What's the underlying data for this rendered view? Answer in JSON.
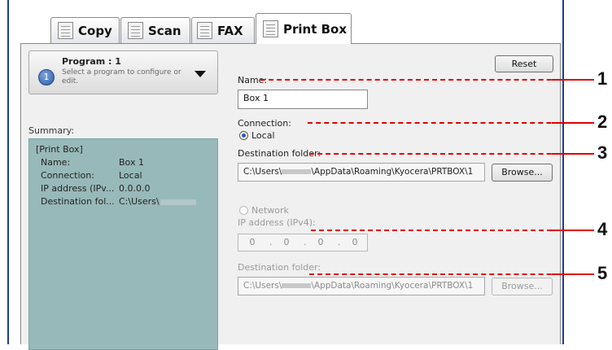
{
  "tabs": [
    {
      "label": "Copy",
      "icon": "copy-icon"
    },
    {
      "label": "Scan",
      "icon": "scan-icon"
    },
    {
      "label": "FAX",
      "icon": "fax-icon"
    },
    {
      "label": "Print Box",
      "icon": "print-box-icon",
      "active": true
    }
  ],
  "program": {
    "number": "1",
    "title": "Program : 1",
    "hint": "Select a program to configure or edit."
  },
  "summary": {
    "label": "Summary:",
    "title": "[Print Box]",
    "rows": [
      {
        "key": "Name:",
        "value": "Box 1"
      },
      {
        "key": "Connection:",
        "value": "Local"
      },
      {
        "key": "IP address (IPv...",
        "value": "0.0.0.0"
      },
      {
        "key": "Destination fol...",
        "value": "C:\\Users\\"
      }
    ]
  },
  "form": {
    "reset_label": "Reset",
    "name_label": "Name:",
    "name_value": "Box 1",
    "connection_label": "Connection:",
    "local_label": "Local",
    "dest_label": "Destination folder:",
    "dest_path_prefix": "C:\\Users\\",
    "dest_path_suffix": "\\AppData\\Roaming\\Kyocera\\PRTBOX\\1",
    "browse_label": "Browse...",
    "network_label": "Network",
    "ip_label": "IP address (IPv4):",
    "ip_octets": [
      "0",
      "0",
      "0",
      "0"
    ],
    "dest2_label": "Destination folder:",
    "dest2_path_prefix": "C:\\Users\\",
    "dest2_path_suffix": "\\AppData\\Roaming\\Kyocera\\PRTBOX\\1",
    "browse2_label": "Browse..."
  },
  "callouts": [
    "1",
    "2",
    "3",
    "4",
    "5"
  ],
  "colors": {
    "callout": "#e00000",
    "summary_bg": "#98b9b9",
    "frame": "#1f3f86"
  }
}
